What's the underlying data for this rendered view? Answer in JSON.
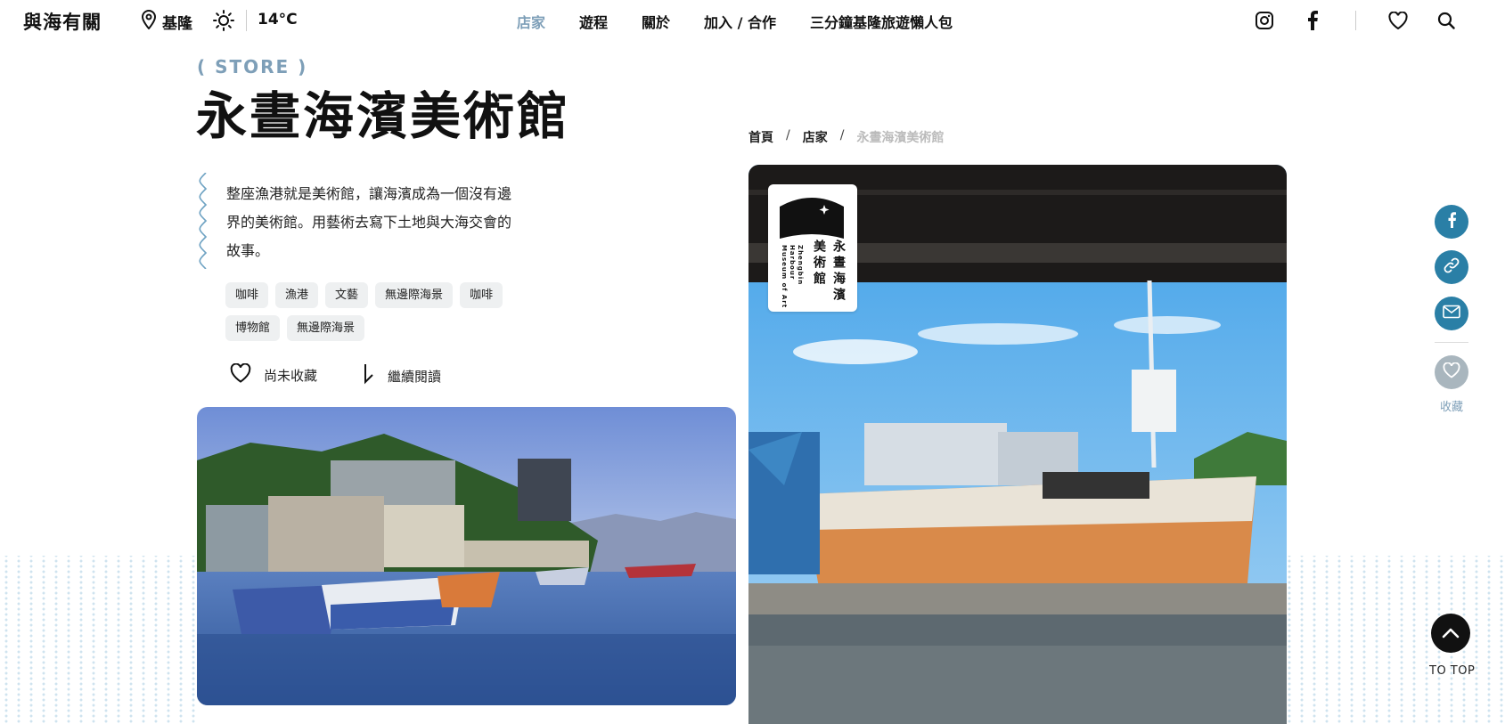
{
  "header": {
    "logo": "與海有關",
    "location": "基隆",
    "temperature": "14°C",
    "nav": [
      {
        "label": "店家",
        "active": true
      },
      {
        "label": "遊程",
        "active": false
      },
      {
        "label": "關於",
        "active": false
      },
      {
        "label": "加入 / 合作",
        "active": false
      },
      {
        "label": "三分鐘基隆旅遊懶人包",
        "active": false
      }
    ]
  },
  "store": {
    "category_tag": "( STORE )",
    "title": "永晝海濱美術館",
    "description": "整座漁港就是美術館，讓海濱成為一個沒有邊界的美術館。用藝術去寫下土地與大海交會的故事。",
    "tags": [
      "咖啡",
      "漁港",
      "文藝",
      "無邊際海景",
      "咖啡",
      "博物館",
      "無邊際海景"
    ],
    "save_label": "尚未收藏",
    "read_more_label": "繼續閱讀"
  },
  "breadcrumb": {
    "home": "首頁",
    "section": "店家",
    "current": "永晝海濱美術館"
  },
  "museum_logo": {
    "name_cn_col1": "永晝海濱",
    "name_cn_col2": "美術館",
    "name_en": "Zhengbin Harbour Museum of Art"
  },
  "sidebar": {
    "save_label": "收藏",
    "top_label": "TO TOP"
  },
  "colors": {
    "accent": "#7e9fb8",
    "share_blue": "#2a7fa6",
    "tag_bg": "#eef0f1"
  }
}
